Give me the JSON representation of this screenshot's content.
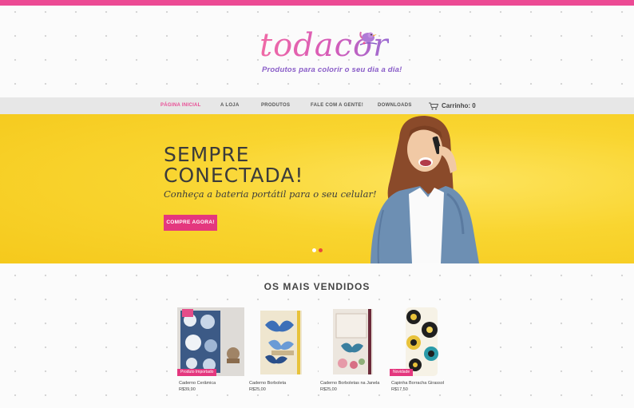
{
  "brand": {
    "logo_text": "todacor",
    "tagline": "Produtos para colorir o seu dia a dia!",
    "accent_color": "#ec4a94"
  },
  "nav": {
    "items": [
      "PÁGINA INICIAL",
      "A LOJA",
      "PRODUTOS",
      "FALE COM A GENTE!",
      "DOWNLOADS"
    ],
    "active_index": 0,
    "cart_label": "Carrinho: 0",
    "cart_icon": "shopping-cart-icon"
  },
  "hero": {
    "title_line1": "SEMPRE",
    "title_line2": "CONECTADA!",
    "subtitle": "Conheça a bateria portátil para o seu celular!",
    "cta_label": "COMPRE AGORA!",
    "background_color": "#f9d530",
    "slides_count": 2,
    "active_slide": 1
  },
  "bestsellers": {
    "title": "OS MAIS VENDIDOS",
    "products": [
      {
        "name": "Caderno Cerâmica",
        "price": "R$39,90",
        "badge": "Produto Importado"
      },
      {
        "name": "Caderno Borboleta",
        "price": "R$25,00",
        "badge": ""
      },
      {
        "name": "Caderno Borboletas na Janela",
        "price": "R$25,00",
        "badge": ""
      },
      {
        "name": "Capinha Borracha Girassol",
        "price": "R$17,50",
        "badge": "Novidade"
      }
    ]
  }
}
